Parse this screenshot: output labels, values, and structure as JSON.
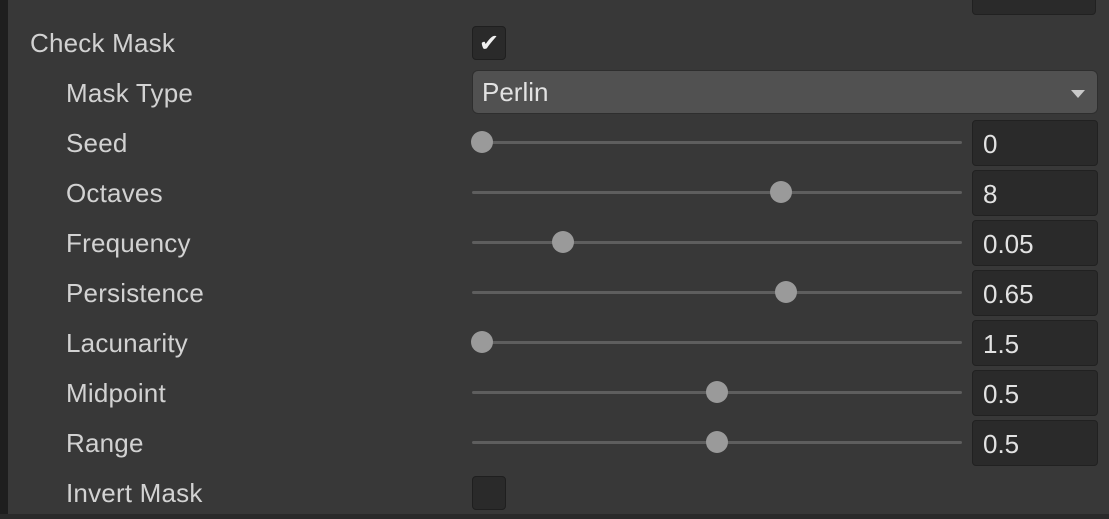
{
  "check_mask": {
    "label": "Check Mask",
    "checked": true,
    "check_glyph": "✔"
  },
  "mask_type": {
    "label": "Mask Type",
    "value": "Perlin",
    "icon": "chevron-down-icon"
  },
  "sliders": [
    {
      "key": "seed",
      "label": "Seed",
      "value": "0",
      "level": 0.02
    },
    {
      "key": "octaves",
      "label": "Octaves",
      "value": "8",
      "level": 0.63
    },
    {
      "key": "frequency",
      "label": "Frequency",
      "value": "0.05",
      "level": 0.185
    },
    {
      "key": "persistence",
      "label": "Persistence",
      "value": "0.65",
      "level": 0.64
    },
    {
      "key": "lacunarity",
      "label": "Lacunarity",
      "value": "1.5",
      "level": 0.02
    },
    {
      "key": "midpoint",
      "label": "Midpoint",
      "value": "0.5",
      "level": 0.5
    },
    {
      "key": "range",
      "label": "Range",
      "value": "0.5",
      "level": 0.5
    }
  ],
  "invert_mask": {
    "label": "Invert Mask",
    "checked": false
  },
  "colors": {
    "background": "#383838",
    "field": "#2a2a2a",
    "dropdown": "#515151",
    "thumb": "#9a9a9a",
    "text": "#d2d2d2"
  }
}
